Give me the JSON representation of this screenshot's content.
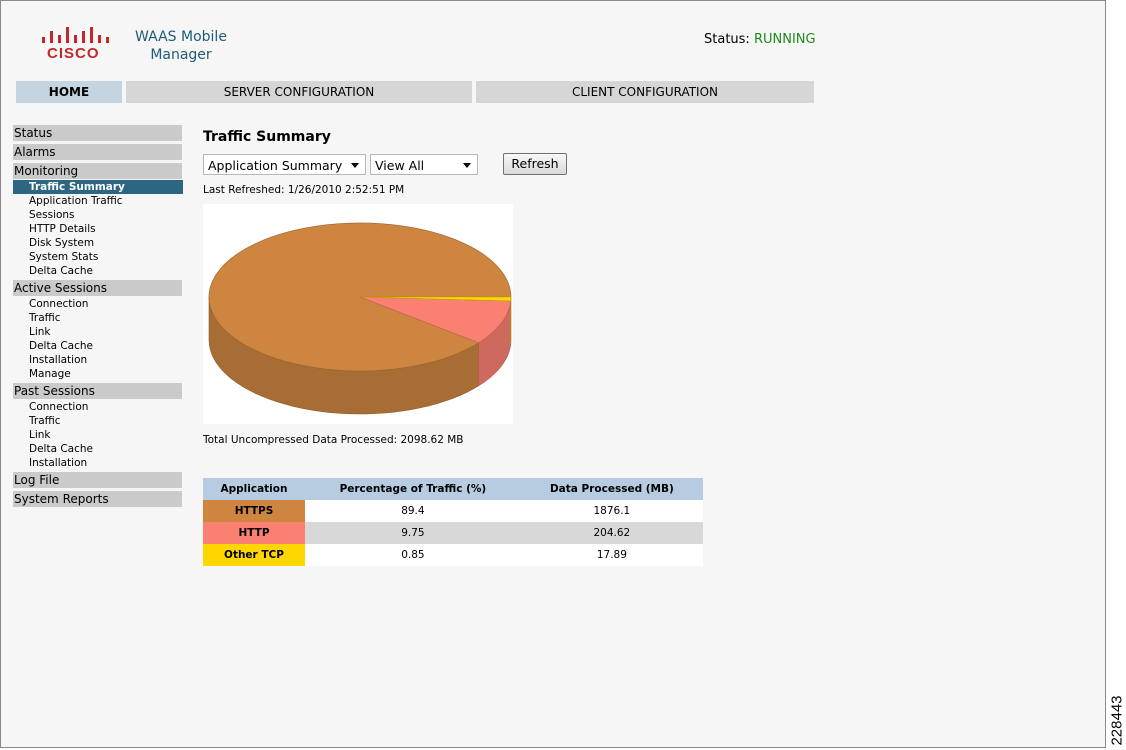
{
  "header": {
    "logo_text": "CISCO",
    "product_line1": "WAAS Mobile",
    "product_line2": "Manager",
    "status_label": "Status:",
    "status_value": "RUNNING"
  },
  "nav": {
    "tabs": [
      {
        "label": "HOME",
        "active": true
      },
      {
        "label": "SERVER CONFIGURATION",
        "active": false
      },
      {
        "label": "CLIENT CONFIGURATION",
        "active": false
      }
    ]
  },
  "sidebar": {
    "status": "Status",
    "alarms": "Alarms",
    "monitoring": {
      "label": "Monitoring",
      "items": [
        "Traffic Summary",
        "Application Traffic",
        "Sessions",
        "HTTP Details",
        "Disk System",
        "System Stats",
        "Delta Cache"
      ],
      "selected": "Traffic Summary"
    },
    "active_sessions": {
      "label": "Active Sessions",
      "items": [
        "Connection",
        "Traffic",
        "Link",
        "Delta Cache",
        "Installation",
        "Manage"
      ]
    },
    "past_sessions": {
      "label": "Past Sessions",
      "items": [
        "Connection",
        "Traffic",
        "Link",
        "Delta Cache",
        "Installation"
      ]
    },
    "log_file": "Log File",
    "system_reports": "System Reports"
  },
  "main": {
    "title": "Traffic Summary",
    "summary_select": "Application Summary",
    "view_select": "View All",
    "refresh_label": "Refresh",
    "last_refreshed": "Last Refreshed: 1/26/2010 2:52:51 PM",
    "total": "Total Uncompressed Data Processed: 2098.62 MB"
  },
  "table": {
    "headers": [
      "Application",
      "Percentage of Traffic (%)",
      "Data Processed (MB)"
    ],
    "rows": [
      {
        "app": "HTTPS",
        "pct": "89.4",
        "mb": "1876.1",
        "color": "#cd8540"
      },
      {
        "app": "HTTP",
        "pct": "9.75",
        "mb": "204.62",
        "color": "#fa8072"
      },
      {
        "app": "Other TCP",
        "pct": "0.85",
        "mb": "17.89",
        "color": "#ffd700"
      }
    ]
  },
  "chart_data": {
    "type": "pie",
    "style": "3d",
    "categories": [
      "HTTPS",
      "HTTP",
      "Other TCP"
    ],
    "values": [
      89.4,
      9.75,
      0.85
    ],
    "colors": [
      "#cd8540",
      "#fa8072",
      "#ffd700"
    ]
  },
  "side_id": "228443"
}
